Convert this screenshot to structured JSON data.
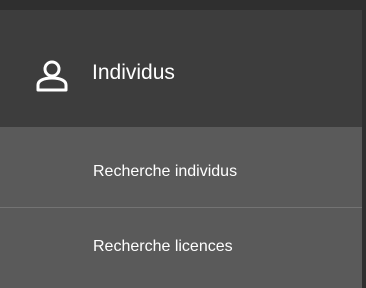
{
  "nav": {
    "section": {
      "icon": "user-outline-icon",
      "title": "Individus"
    },
    "items": [
      {
        "label": "Recherche individus"
      },
      {
        "label": "Recherche licences"
      }
    ]
  },
  "colors": {
    "header_bg": "#3d3d3d",
    "submenu_bg": "#5a5a5a",
    "text": "#ffffff"
  }
}
